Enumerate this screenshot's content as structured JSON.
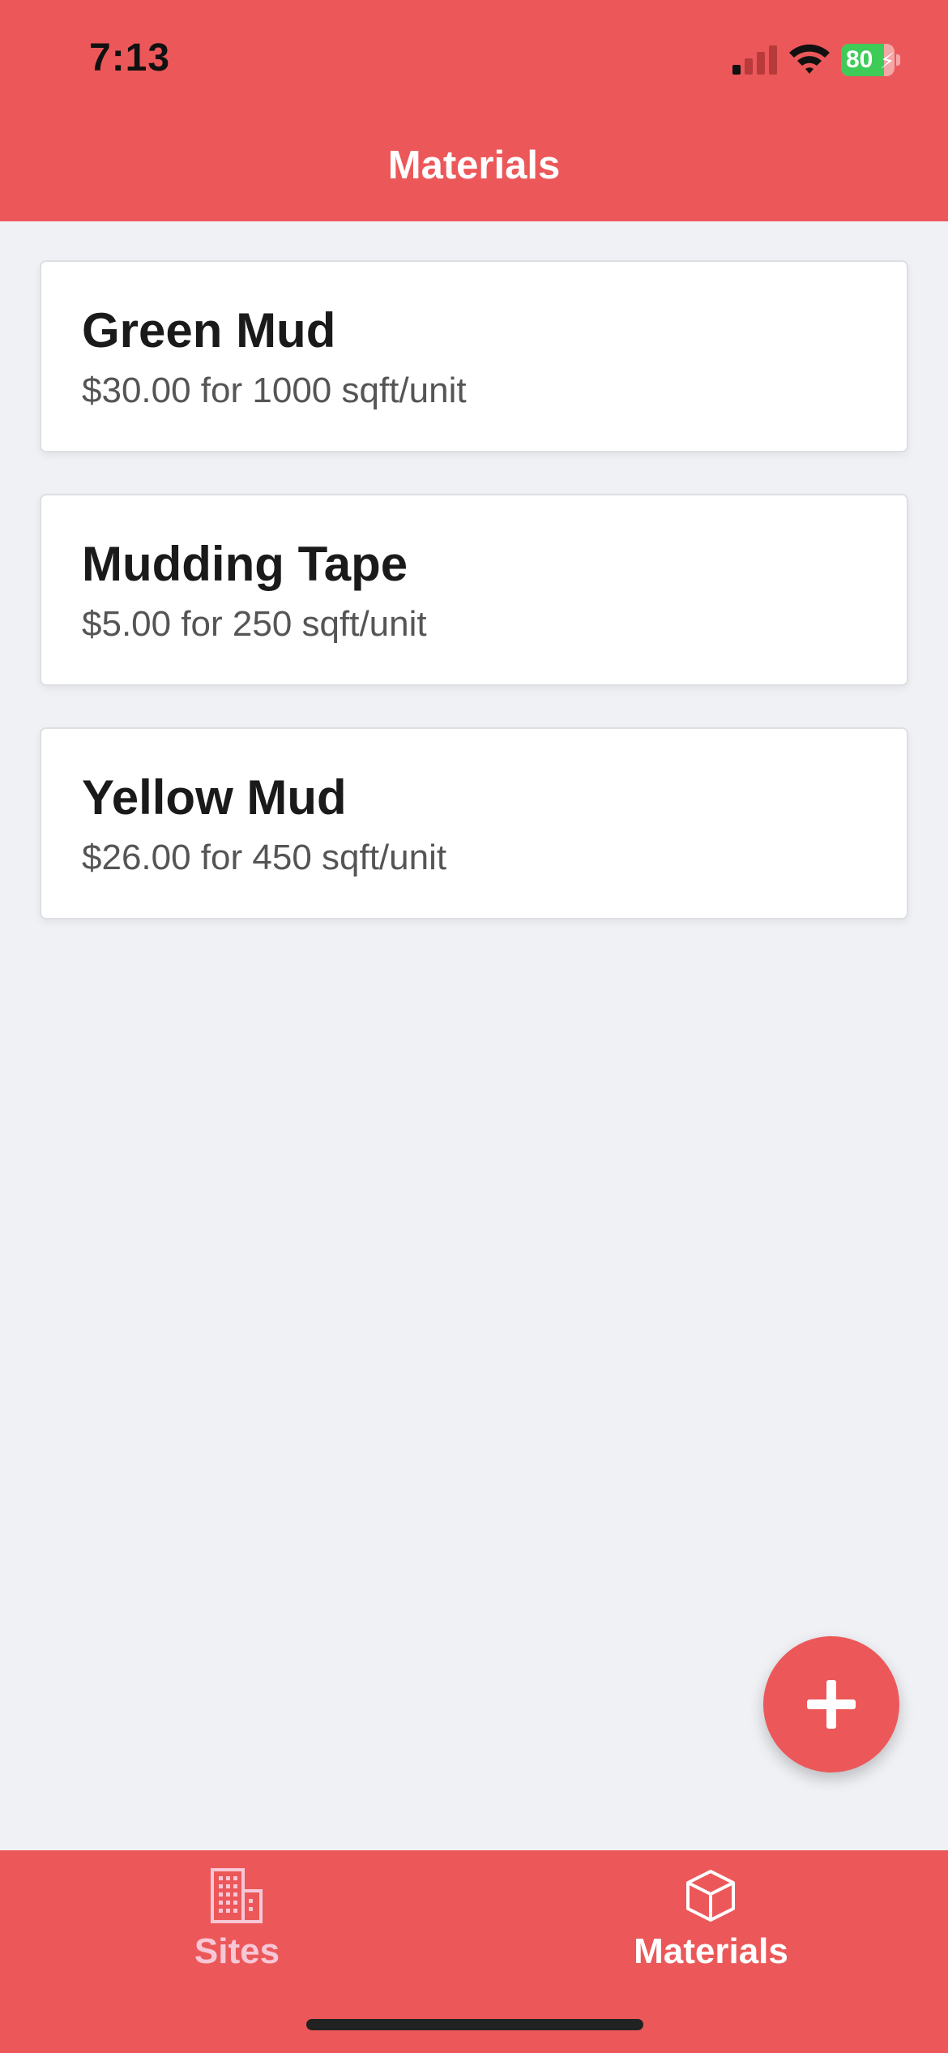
{
  "status_bar": {
    "time": "7:13",
    "battery_percent": "80",
    "battery_level": 0.8,
    "signal_bars_active": 1,
    "signal_bars_total": 4,
    "icons": [
      "signal-icon",
      "wifi-icon",
      "battery-icon",
      "charging-bolt-icon"
    ]
  },
  "header": {
    "title": "Materials",
    "background": "#ec5859"
  },
  "materials": [
    {
      "name": "Green Mud",
      "detail": "$30.00 for 1000 sqft/unit"
    },
    {
      "name": "Mudding Tape",
      "detail": "$5.00 for 250 sqft/unit"
    },
    {
      "name": "Yellow Mud",
      "detail": "$26.00 for 450 sqft/unit"
    }
  ],
  "fab": {
    "icon": "plus-icon"
  },
  "tabbar": {
    "tabs": [
      {
        "label": "Sites",
        "icon": "building-icon",
        "active": false
      },
      {
        "label": "Materials",
        "icon": "cube-icon",
        "active": true
      }
    ]
  },
  "colors": {
    "accent": "#ec5859",
    "background": "#f0f1f5",
    "tab_active": "#ffffff",
    "tab_inactive": "#f6c7d6"
  }
}
